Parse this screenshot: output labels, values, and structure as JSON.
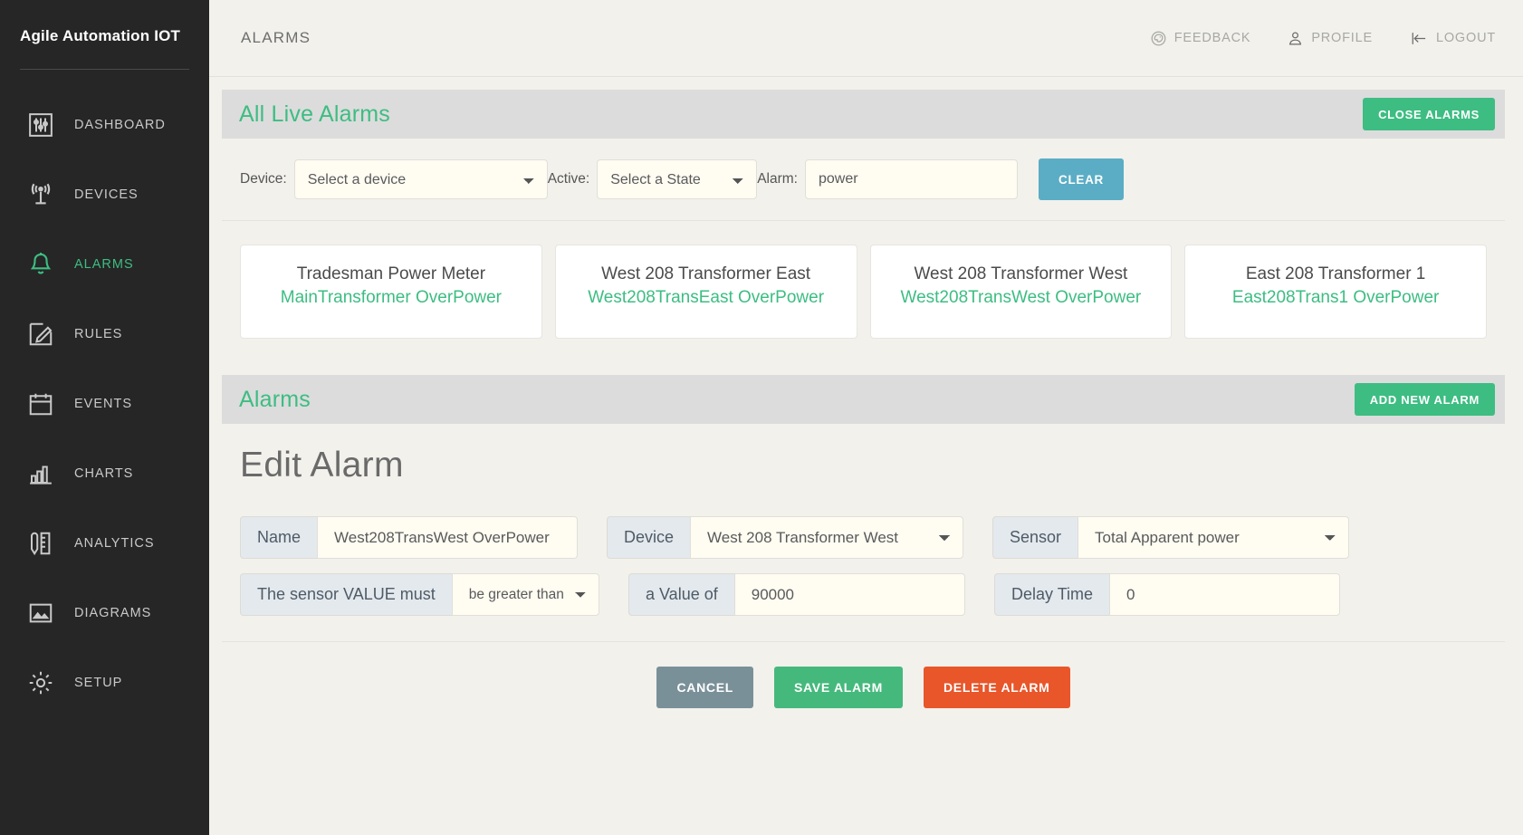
{
  "sidebar": {
    "brand": "Agile Automation IOT",
    "items": [
      {
        "label": "DASHBOARD",
        "icon": "sliders-icon",
        "active": false
      },
      {
        "label": "DEVICES",
        "icon": "antenna-icon",
        "active": false
      },
      {
        "label": "ALARMS",
        "icon": "bell-icon",
        "active": true
      },
      {
        "label": "RULES",
        "icon": "pencil-square-icon",
        "active": false
      },
      {
        "label": "EVENTS",
        "icon": "calendar-icon",
        "active": false
      },
      {
        "label": "CHARTS",
        "icon": "bar-chart-icon",
        "active": false
      },
      {
        "label": "ANALYTICS",
        "icon": "pencil-ruler-icon",
        "active": false
      },
      {
        "label": "DIAGRAMS",
        "icon": "image-icon",
        "active": false
      },
      {
        "label": "SETUP",
        "icon": "gear-icon",
        "active": false
      }
    ]
  },
  "topbar": {
    "title": "ALARMS",
    "feedback": "FEEDBACK",
    "profile": "PROFILE",
    "logout": "LOGOUT"
  },
  "live_alarms": {
    "heading": "All Live Alarms",
    "close_button": "CLOSE ALARMS",
    "filters": {
      "device_label": "Device:",
      "device_value": "Select a device",
      "active_label": "Active:",
      "active_value": "Select a State",
      "alarm_label": "Alarm:",
      "alarm_value": "power",
      "clear_button": "CLEAR"
    },
    "cards": [
      {
        "device": "Tradesman Power Meter",
        "alarm": "MainTransformer OverPower"
      },
      {
        "device": "West 208 Transformer East",
        "alarm": "West208TransEast OverPower"
      },
      {
        "device": "West 208 Transformer West",
        "alarm": "West208TransWest OverPower"
      },
      {
        "device": "East 208 Transformer 1",
        "alarm": "East208Trans1 OverPower"
      }
    ]
  },
  "alarms_panel": {
    "heading": "Alarms",
    "add_button": "ADD NEW ALARM"
  },
  "edit_alarm": {
    "title": "Edit Alarm",
    "name_label": "Name",
    "name_value": "West208TransWest OverPower",
    "device_label": "Device",
    "device_value": "West 208 Transformer West",
    "sensor_label": "Sensor",
    "sensor_value": "Total Apparent power",
    "condition_label": "The sensor VALUE must",
    "condition_value": "be greater than",
    "value_label": "a Value of",
    "value_value": "90000",
    "delay_label": "Delay Time",
    "delay_value": "0",
    "cancel_button": "CANCEL",
    "save_button": "SAVE ALARM",
    "delete_button": "DELETE ALARM"
  },
  "colors": {
    "accent_green": "#3dbd82",
    "sidebar_bg": "#262626",
    "page_bg": "#f2f1ec",
    "clear_blue": "#5aadc4",
    "delete_red": "#e8562a",
    "cancel_slate": "#7a9099"
  }
}
